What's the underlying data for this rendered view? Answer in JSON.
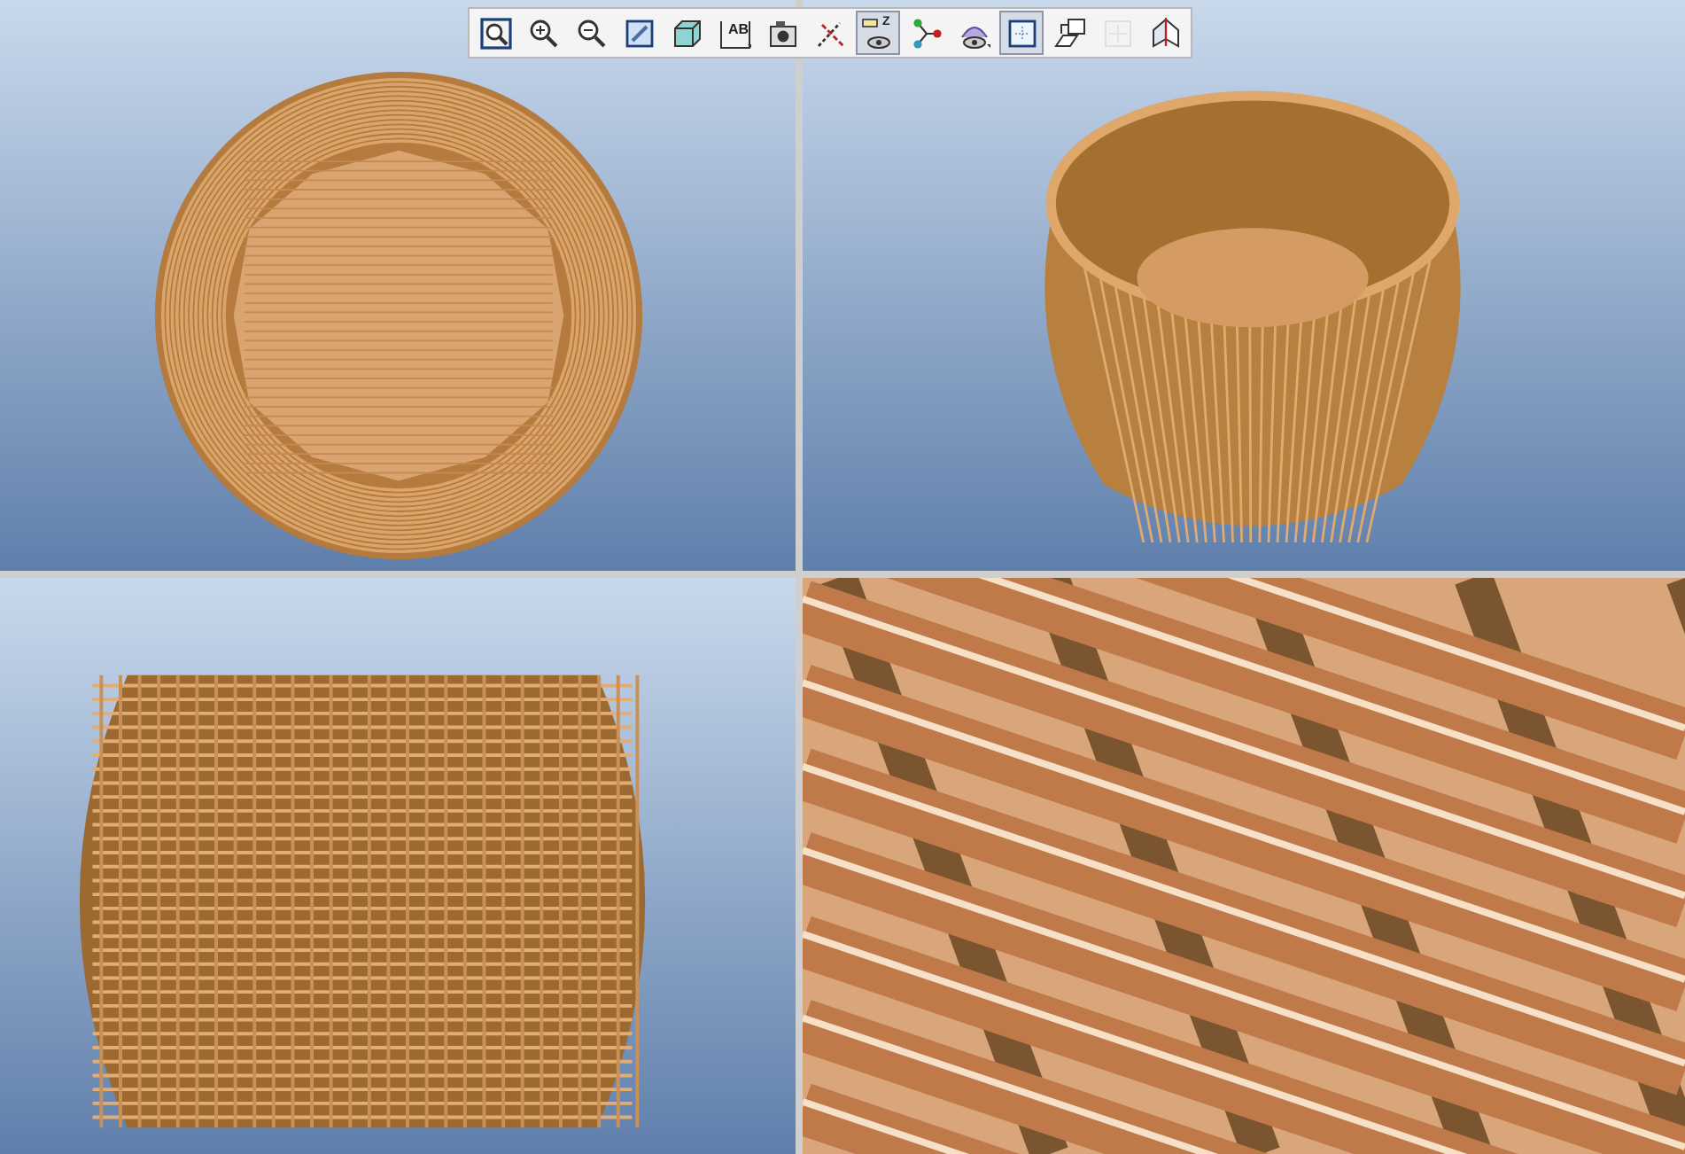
{
  "toolbar": {
    "tools": [
      {
        "kind": "zoom-fit",
        "pressed": false,
        "disabled": false
      },
      {
        "kind": "zoom-in",
        "pressed": false,
        "disabled": false
      },
      {
        "kind": "zoom-out",
        "pressed": false,
        "disabled": false
      },
      {
        "kind": "repaint",
        "pressed": false,
        "disabled": false
      },
      {
        "kind": "cube",
        "pressed": false,
        "disabled": false
      },
      {
        "kind": "named-view",
        "glyph": "AB",
        "pressed": false,
        "disabled": false
      },
      {
        "kind": "camera",
        "pressed": false,
        "disabled": false
      },
      {
        "kind": "datum",
        "pressed": false,
        "disabled": false
      },
      {
        "kind": "annotation",
        "glyph": "Z",
        "pressed": true,
        "disabled": false
      },
      {
        "kind": "nodes",
        "pressed": false,
        "disabled": false
      },
      {
        "kind": "spin",
        "pressed": false,
        "disabled": false
      },
      {
        "kind": "frame",
        "pressed": true,
        "disabled": false
      },
      {
        "kind": "orient",
        "pressed": false,
        "disabled": false
      },
      {
        "kind": "grid",
        "pressed": false,
        "disabled": true
      },
      {
        "kind": "plane",
        "pressed": false,
        "disabled": false
      }
    ]
  },
  "viewports": [
    {
      "kind": "top"
    },
    {
      "kind": "iso"
    },
    {
      "kind": "front"
    },
    {
      "kind": "closeup"
    }
  ]
}
